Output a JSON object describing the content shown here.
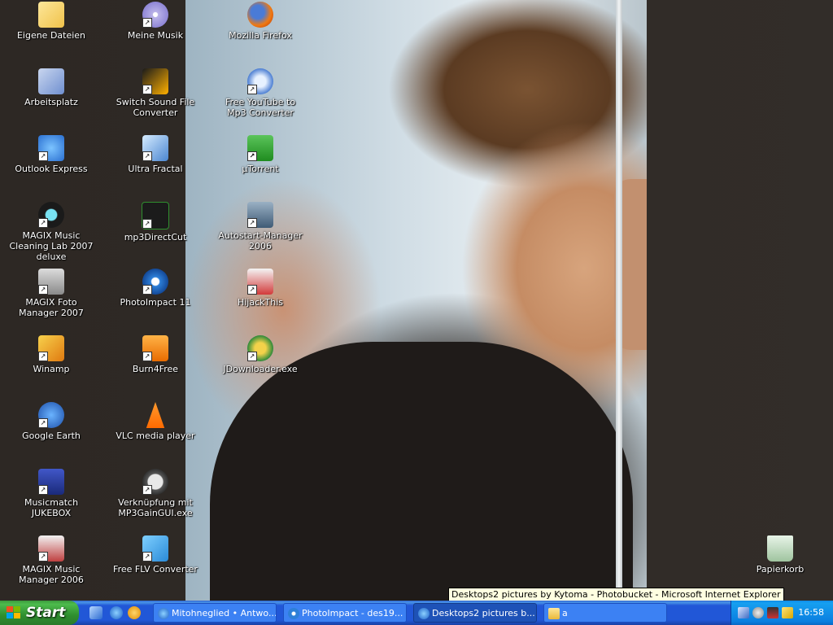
{
  "desktop_icons": [
    {
      "label": "Eigene Dateien",
      "icon": "my-documents-icon"
    },
    {
      "label": "Arbeitsplatz",
      "icon": "my-computer-icon"
    },
    {
      "label": "Outlook Express",
      "icon": "outlook-express-icon"
    },
    {
      "label": "MAGIX Music Cleaning Lab 2007 deluxe",
      "icon": "magix-cleaning-lab-icon"
    },
    {
      "label": "MAGIX Foto Manager 2007",
      "icon": "camera-icon"
    },
    {
      "label": "Winamp",
      "icon": "winamp-icon"
    },
    {
      "label": "Google Earth",
      "icon": "globe-icon"
    },
    {
      "label": "Musicmatch JUKEBOX",
      "icon": "musicmatch-icon"
    },
    {
      "label": "MAGIX Music Manager 2006",
      "icon": "magix-music-manager-icon"
    },
    {
      "label": "Meine Musik",
      "icon": "music-cd-icon"
    },
    {
      "label": "Switch Sound File Converter",
      "icon": "switch-converter-icon"
    },
    {
      "label": "Ultra Fractal",
      "icon": "fractal-icon"
    },
    {
      "label": "mp3DirectCut",
      "icon": "mp3directcut-icon"
    },
    {
      "label": "PhotoImpact 11",
      "icon": "photoimpact-icon"
    },
    {
      "label": "Burn4Free",
      "icon": "burn4free-icon"
    },
    {
      "label": "VLC media player",
      "icon": "vlc-cone-icon"
    },
    {
      "label": "Verknüpfung mit MP3GainGUI.exe",
      "icon": "mp3gain-icon"
    },
    {
      "label": "Free FLV Converter",
      "icon": "flv-converter-icon"
    },
    {
      "label": "Mozilla Firefox",
      "icon": "firefox-icon"
    },
    {
      "label": "Free YouTube to Mp3 Converter",
      "icon": "youtube-mp3-icon"
    },
    {
      "label": "µTorrent",
      "icon": "utorrent-icon"
    },
    {
      "label": "Autostart-Manager 2006",
      "icon": "autostart-manager-icon"
    },
    {
      "label": "HijackThis",
      "icon": "hijackthis-icon"
    },
    {
      "label": "JDownloader.exe",
      "icon": "jdownloader-icon"
    },
    {
      "label": "Papierkorb",
      "icon": "recycle-bin-icon"
    }
  ],
  "taskbar": {
    "start_label": "Start",
    "quick_launch": [
      "show-desktop-icon",
      "internet-explorer-icon",
      "media-player-icon"
    ],
    "tasks": [
      {
        "label": "Mitohneglied • Antwo...",
        "icon": "internet-explorer-icon",
        "active": false
      },
      {
        "label": "PhotoImpact - des19...",
        "icon": "photoimpact-icon",
        "active": false
      },
      {
        "label": "Desktops2 pictures b...",
        "icon": "internet-explorer-icon",
        "active": true
      },
      {
        "label": "a",
        "icon": "folder-icon",
        "active": false
      }
    ],
    "tray_icons": [
      "network-icon",
      "volume-icon",
      "monitor-icon",
      "pencil-icon"
    ],
    "clock": "16:58"
  },
  "tooltip": "Desktops2 pictures by Kytoma - Photobucket - Microsoft Internet Explorer",
  "colors": {
    "taskbar": "#2157d7",
    "start": "#3c9a3c",
    "tray": "#0f8ae8"
  }
}
